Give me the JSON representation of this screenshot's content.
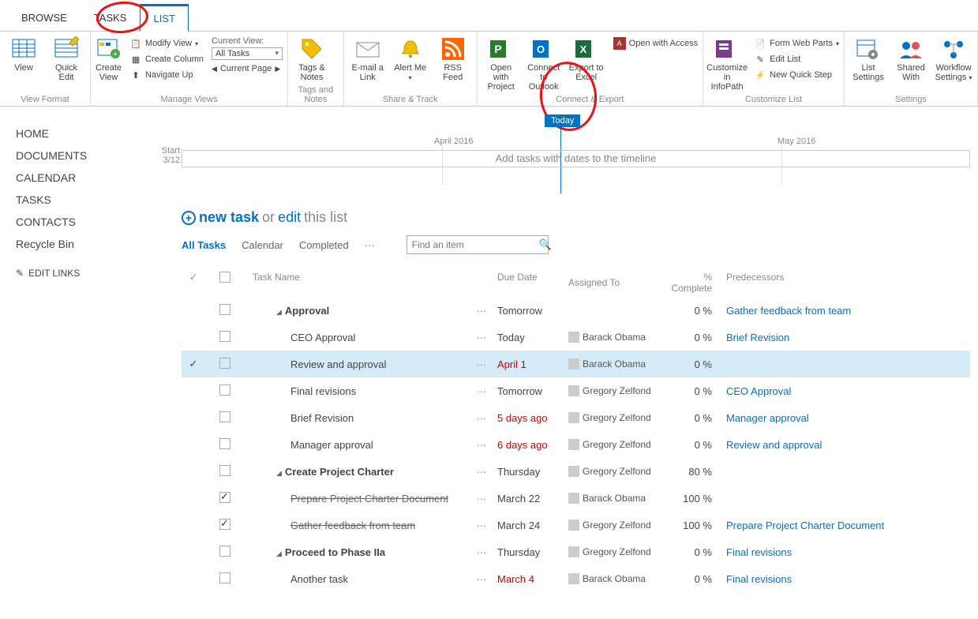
{
  "tabs": {
    "browse": "BROWSE",
    "tasks": "TASKS",
    "list": "LIST"
  },
  "ribbon": {
    "view": "View",
    "quick_edit": "Quick Edit",
    "create_view": "Create View",
    "modify_view": "Modify View",
    "create_column": "Create Column",
    "navigate_up": "Navigate Up",
    "current_view_label": "Current View:",
    "current_view_value": "All Tasks",
    "current_page": "Current Page",
    "tags_notes": "Tags & Notes",
    "email_link": "E-mail a Link",
    "alert_me": "Alert Me",
    "rss": "RSS Feed",
    "open_project": "Open with Project",
    "connect_outlook": "Connect to Outlook",
    "export_excel": "Export to Excel",
    "open_access": "Open with Access",
    "customize_infopath": "Customize in InfoPath",
    "form_web_parts": "Form Web Parts",
    "edit_list": "Edit List",
    "new_quick_step": "New Quick Step",
    "list_settings": "List Settings",
    "shared_with": "Shared With",
    "workflow_settings": "Workflow Settings",
    "groups": {
      "view_format": "View Format",
      "manage_views": "Manage Views",
      "tags_and_notes": "Tags and Notes",
      "share_track": "Share & Track",
      "connect_export": "Connect & Export",
      "customize_list": "Customize List",
      "settings": "Settings"
    }
  },
  "sidebar": {
    "items": [
      "HOME",
      "DOCUMENTS",
      "CALENDAR",
      "TASKS",
      "CONTACTS",
      "Recycle Bin"
    ],
    "edit_links": "EDIT LINKS"
  },
  "timeline": {
    "today": "Today",
    "start_label": "Start",
    "start_date": "3/12",
    "month1": "April 2016",
    "month2": "May 2016",
    "placeholder": "Add tasks with dates to the timeline"
  },
  "newtask": {
    "new_task": "new task",
    "or": "or",
    "edit": "edit",
    "suffix": "this list"
  },
  "views": {
    "all": "All Tasks",
    "cal": "Calendar",
    "comp": "Completed",
    "more": "···"
  },
  "search": {
    "placeholder": "Find an item"
  },
  "columns": {
    "task_name": "Task Name",
    "due_date": "Due Date",
    "assigned_to": "Assigned To",
    "pct_complete": "% Complete",
    "predecessors": "Predecessors"
  },
  "rows": [
    {
      "name": "Approval",
      "due": "Tomorrow",
      "assigned": "",
      "pct": "0 %",
      "pred": "Gather feedback from team",
      "group": true,
      "indent": 1
    },
    {
      "name": "CEO Approval",
      "due": "Today",
      "assigned": "Barack Obama",
      "pct": "0 %",
      "pred": "Brief Revision",
      "indent": 2
    },
    {
      "name": "Review and approval",
      "due": "April 1",
      "overdue": true,
      "assigned": "Barack Obama",
      "pct": "0 %",
      "pred": "",
      "indent": 2,
      "selected": true,
      "checkmark": true
    },
    {
      "name": "Final revisions",
      "due": "Tomorrow",
      "assigned": "Gregory Zelfond",
      "pct": "0 %",
      "pred": "CEO Approval",
      "indent": 2
    },
    {
      "name": "Brief Revision",
      "due": "5 days ago",
      "overdue": true,
      "assigned": "Gregory Zelfond",
      "pct": "0 %",
      "pred": "Manager approval",
      "indent": 2
    },
    {
      "name": "Manager approval",
      "due": "6 days ago",
      "overdue": true,
      "assigned": "Gregory Zelfond",
      "pct": "0 %",
      "pred": "Review and approval",
      "indent": 2
    },
    {
      "name": "Create Project Charter",
      "due": "Thursday",
      "assigned": "Gregory Zelfond",
      "pct": "80 %",
      "pred": "",
      "group": true,
      "indent": 1
    },
    {
      "name": "Prepare Project Charter Document",
      "due": "March 22",
      "assigned": "Barack Obama",
      "pct": "100 %",
      "pred": "",
      "indent": 2,
      "checked": true,
      "strike": true
    },
    {
      "name": "Gather feedback from team",
      "due": "March 24",
      "assigned": "Gregory Zelfond",
      "pct": "100 %",
      "pred": "Prepare Project Charter Document",
      "indent": 2,
      "checked": true,
      "strike": true
    },
    {
      "name": "Proceed to Phase IIa",
      "due": "Thursday",
      "assigned": "Gregory Zelfond",
      "pct": "0 %",
      "pred": "Final revisions",
      "group": true,
      "indent": 1
    },
    {
      "name": "Another task",
      "due": "March 4",
      "overdue": true,
      "assigned": "Barack Obama",
      "pct": "0 %",
      "pred": "Final revisions",
      "indent": 2
    }
  ]
}
